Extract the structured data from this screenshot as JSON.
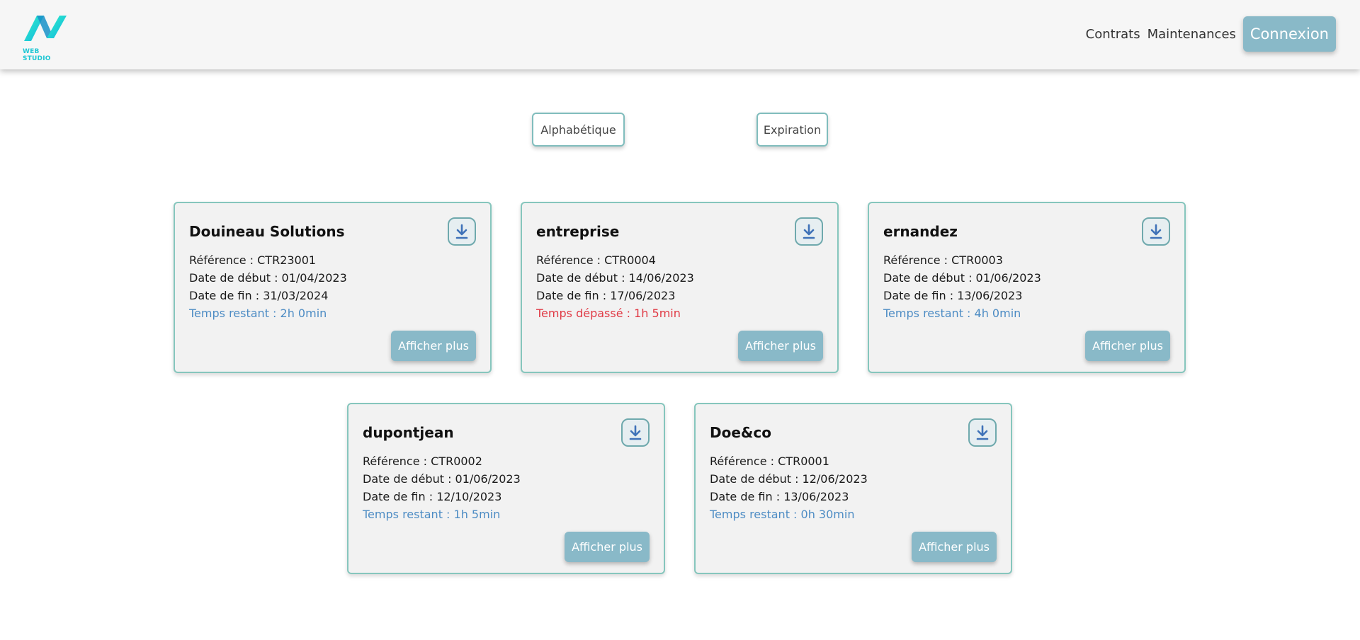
{
  "header": {
    "logo_text": "WEB STUDIO",
    "nav": [
      "Contrats",
      "Maintenances"
    ],
    "login_label": "Connexion"
  },
  "sort": {
    "alpha_label": "Alphabétique",
    "expiration_label": "Expiration"
  },
  "colors": {
    "accent": "#89b9c8",
    "card_border": "#86c6bd",
    "remaining": "#4d8cc4",
    "overdue": "#e03a45",
    "logo": "#1fc7d4"
  },
  "cards": [
    {
      "title": "Douineau Solutions",
      "reference": "Référence : CTR23001",
      "start": "Date de début : 01/04/2023",
      "end": "Date de fin : 31/03/2024",
      "time": "Temps restant : 2h 0min",
      "time_status": "remaining",
      "more_label": "Afficher plus",
      "icon": "download-icon"
    },
    {
      "title": "entreprise",
      "reference": "Référence : CTR0004",
      "start": "Date de début : 14/06/2023",
      "end": "Date de fin : 17/06/2023",
      "time": "Temps dépassé : 1h 5min",
      "time_status": "overdue",
      "more_label": "Afficher plus",
      "icon": "download-icon"
    },
    {
      "title": "ernandez",
      "reference": "Référence : CTR0003",
      "start": "Date de début : 01/06/2023",
      "end": "Date de fin : 13/06/2023",
      "time": "Temps restant : 4h 0min",
      "time_status": "remaining",
      "more_label": "Afficher plus",
      "icon": "download-icon"
    },
    {
      "title": "dupontjean",
      "reference": "Référence : CTR0002",
      "start": "Date de début : 01/06/2023",
      "end": "Date de fin : 12/10/2023",
      "time": "Temps restant : 1h 5min",
      "time_status": "remaining",
      "more_label": "Afficher plus",
      "icon": "download-icon"
    },
    {
      "title": "Doe&co",
      "reference": "Référence : CTR0001",
      "start": "Date de début : 12/06/2023",
      "end": "Date de fin : 13/06/2023",
      "time": "Temps restant : 0h 30min",
      "time_status": "remaining",
      "more_label": "Afficher plus",
      "icon": "download-icon"
    }
  ]
}
